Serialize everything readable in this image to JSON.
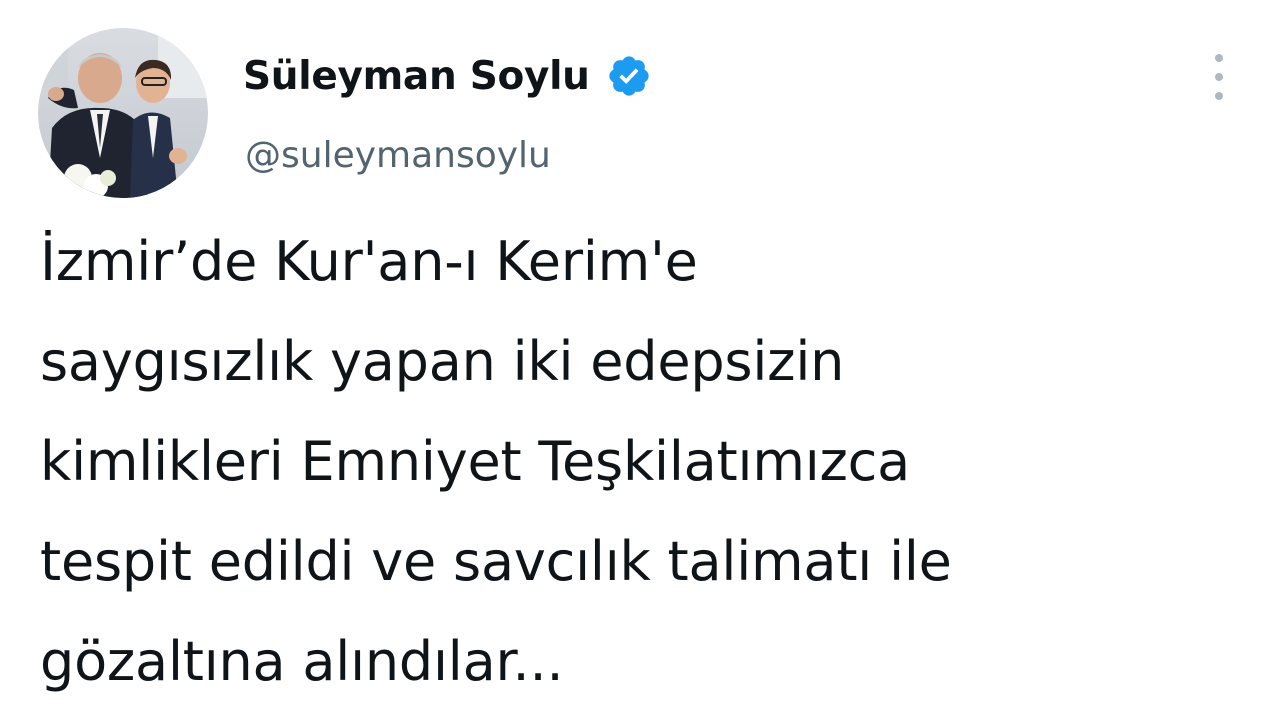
{
  "user": {
    "display_name": "Süleyman Soylu",
    "handle": "@suleymansoylu",
    "verified": true
  },
  "tweet": {
    "text": "İzmir’de Kur'an-ı Kerim'e\nsaygısızlık yapan iki edepsizin\nkimlikleri Emniyet Teşkilatımızca\ntespit edildi ve savcılık talimatı ile\ngözaltına alındılar..."
  },
  "icons": {
    "verified": "verified-badge-icon",
    "more": "more-vertical-icon"
  },
  "colors": {
    "verified_blue": "#1d9bf0",
    "text": "#0f1419",
    "secondary_text": "#536471"
  }
}
